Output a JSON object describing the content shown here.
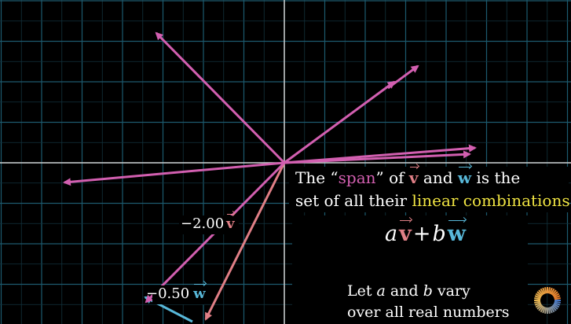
{
  "caption": {
    "line1_prefix": "The “",
    "span_word": "span",
    "line1_mid": "” of ",
    "v_symbol": "v",
    "and_word": " and ",
    "w_symbol": "w",
    "line1_suffix": " is the",
    "line2_prefix": "set of all their ",
    "linear_combinations": "linear combinations",
    "line2_suffix": "."
  },
  "labels": {
    "neg_two_coef": "−2.00",
    "v_symbol": "v",
    "neg_half_coef": "−0.50",
    "w_symbol": "w"
  },
  "formula": {
    "a": "a",
    "v": "v",
    "plus": "+",
    "b": "b",
    "w": "w"
  },
  "note": {
    "line1_prefix": "Let ",
    "a": "a",
    "and_word": " and ",
    "b": "b",
    "line1_suffix": " vary",
    "line2": "over all real numbers"
  },
  "colors": {
    "background": "#000000",
    "grid": "#1c5a6e",
    "axes": "#cfcfcf",
    "combination_vectors": "#d25fb0",
    "v_color": "#e07f86",
    "w_color": "#58b8d9",
    "highlight": "#f0e442"
  },
  "icons": [
    "loading-spinner-icon"
  ]
}
